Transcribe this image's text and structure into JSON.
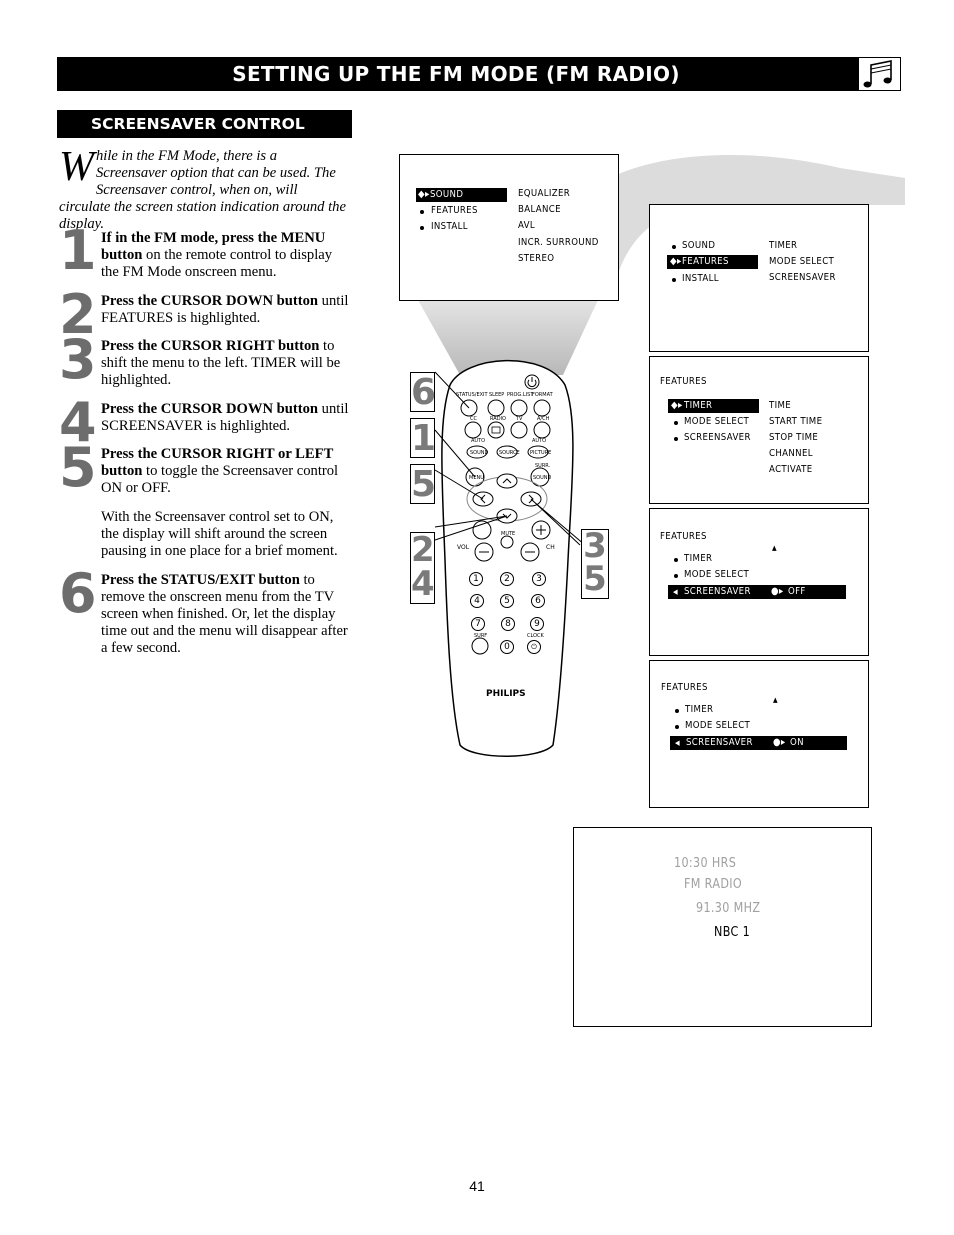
{
  "header": {
    "title": "SETTING UP THE FM MODE (FM RADIO)",
    "icon": "music-note-icon"
  },
  "section": {
    "title": "SCREENSAVER CONTROL"
  },
  "intro": {
    "dropcap": "W",
    "text": "hile in the FM Mode, there is a Screensaver option that can be used. The Screensaver control, when on, will circulate the screen station indication around the display."
  },
  "steps": [
    {
      "number": "1",
      "bold": "If in the FM mode, press the MENU button",
      "rest": " on the remote control to display the FM Mode onscreen menu."
    },
    {
      "number": "2",
      "bold": "Press the CURSOR DOWN button",
      "rest": " until FEATURES is highlighted."
    },
    {
      "number": "3",
      "bold": "Press the CURSOR RIGHT button",
      "rest": " to shift the menu to the left. TIMER will be highlighted."
    },
    {
      "number": "4",
      "bold": "Press the CURSOR DOWN button",
      "rest": " until SCREENSAVER is highlighted."
    },
    {
      "number": "5",
      "bold": "Press the CURSOR RIGHT or LEFT button",
      "rest": " to toggle the Screensaver control ON or OFF."
    },
    {
      "number": "",
      "bold": "",
      "rest": "With the Screensaver control set to ON, the display will shift around the screen pausing in one place for a brief moment."
    },
    {
      "number": "6",
      "bold": "Press the STATUS/EXIT button",
      "rest": " to remove the onscreen menu from the TV screen when finished. Or, let the display time out and the menu will disappear after a few second."
    }
  ],
  "screens": {
    "main_menu": {
      "left": [
        "SOUND",
        "FEATURES",
        "INSTALL"
      ],
      "selected": "SOUND",
      "right": [
        "EQUALIZER",
        "BALANCE",
        "AVL",
        "INCR. SURROUND",
        "STEREO"
      ]
    },
    "features_selected": {
      "left": [
        "SOUND",
        "FEATURES",
        "INSTALL"
      ],
      "selected": "FEATURES",
      "right": [
        "TIMER",
        "MODE SELECT",
        "SCREENSAVER"
      ]
    },
    "features_menu": {
      "heading": "FEATURES",
      "left": [
        "TIMER",
        "MODE SELECT",
        "SCREENSAVER"
      ],
      "selected": "TIMER",
      "right": [
        "TIME",
        "START TIME",
        "STOP TIME",
        "CHANNEL",
        "ACTIVATE"
      ]
    },
    "screensaver_off": {
      "heading": "FEATURES",
      "items": [
        "TIMER",
        "MODE SELECT"
      ],
      "selected": "SCREENSAVER",
      "value": "OFF"
    },
    "screensaver_on": {
      "heading": "FEATURES",
      "items": [
        "TIMER",
        "MODE SELECT"
      ],
      "selected": "SCREENSAVER",
      "value": "ON"
    },
    "fm_display": {
      "time": "10:30 HRS",
      "mode": "FM RADIO",
      "frequency": "91.30 MHZ",
      "station": "NBC 1"
    }
  },
  "remote": {
    "brand": "PHILIPS",
    "top_labels": [
      "STATUS/EXIT",
      "SLEEP",
      "PROG.LIST",
      "FORMAT"
    ],
    "second_labels": [
      "CC",
      "RADIO",
      "TV",
      "A/CH"
    ],
    "auto_buttons": [
      "SOUND",
      "SOURCE",
      "PICTURE"
    ],
    "auto_label": "AUTO",
    "menu": "MENU",
    "surr_label": "SURR.",
    "surr_sound": "SOUND",
    "mute": "MUTE",
    "vol": "VOL",
    "ch": "CH",
    "digits": [
      "1",
      "2",
      "3",
      "4",
      "5",
      "6",
      "7",
      "8",
      "9",
      "0"
    ],
    "surf": "SURF",
    "clock": "CLOCK",
    "callouts_left": [
      "6",
      "1",
      "5",
      "2\n4"
    ],
    "callouts_right": [
      "3\n5"
    ]
  },
  "footer": {
    "page_number": "41"
  }
}
